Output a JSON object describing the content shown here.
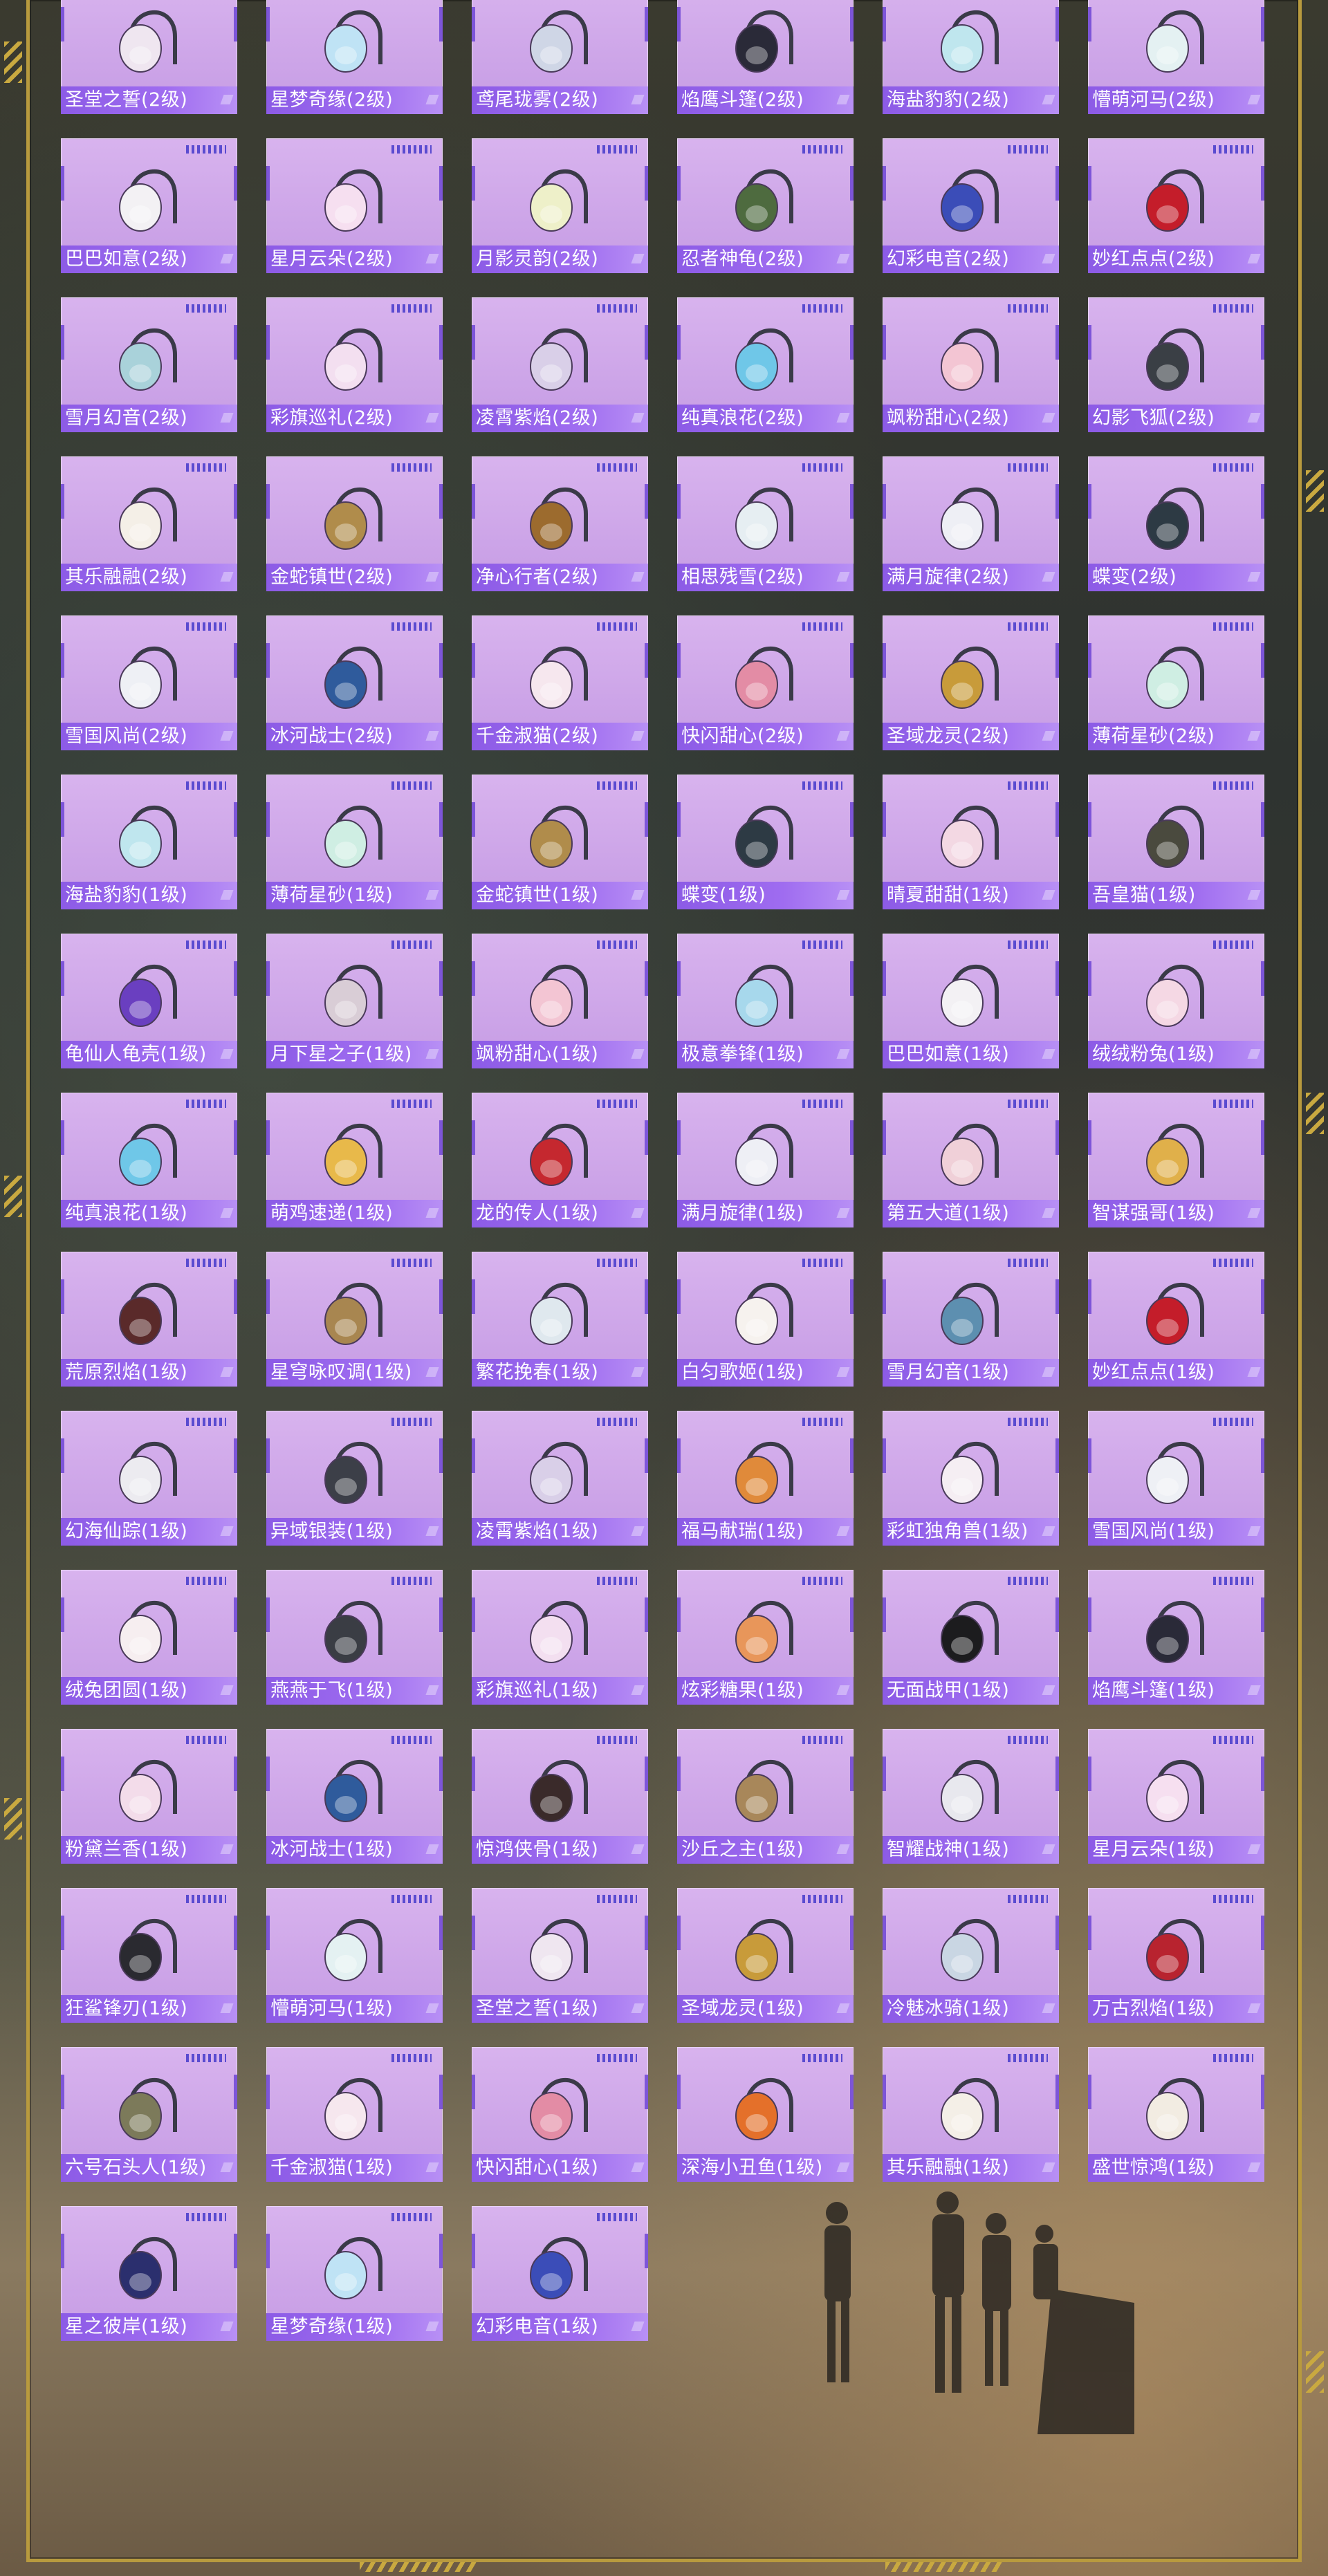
{
  "items": [
    {
      "name": "圣堂之誓(2级)",
      "icon": "bag-icon",
      "color": "#efe6f0"
    },
    {
      "name": "星梦奇缘(2级)",
      "icon": "bag-icon",
      "color": "#bfe3f5"
    },
    {
      "name": "鸢尾珑雾(2级)",
      "icon": "bag-icon",
      "color": "#cfd6e6"
    },
    {
      "name": "焰鹰斗篷(2级)",
      "icon": "bag-icon",
      "color": "#2a2a38"
    },
    {
      "name": "海盐豹豹(2级)",
      "icon": "bag-icon",
      "color": "#bfe6ee"
    },
    {
      "name": "懵萌河马(2级)",
      "icon": "bag-icon",
      "color": "#e4f1f2"
    },
    {
      "name": "巴巴如意(2级)",
      "icon": "bag-icon",
      "color": "#f3f1f4"
    },
    {
      "name": "星月云朵(2级)",
      "icon": "bag-icon",
      "color": "#f6dff0"
    },
    {
      "name": "月影灵韵(2级)",
      "icon": "bag-icon",
      "color": "#eef0c9"
    },
    {
      "name": "忍者神龟(2级)",
      "icon": "bag-icon",
      "color": "#4e6b3f"
    },
    {
      "name": "幻彩电音(2级)",
      "icon": "bag-icon",
      "color": "#3b4db8"
    },
    {
      "name": "妙红点点(2级)",
      "icon": "bag-icon",
      "color": "#c41d2a"
    },
    {
      "name": "雪月幻音(2级)",
      "icon": "bag-icon",
      "color": "#a9d2da"
    },
    {
      "name": "彩旗巡礼(2级)",
      "icon": "bag-icon",
      "color": "#f3dff0"
    },
    {
      "name": "凌霄紫焰(2级)",
      "icon": "bag-icon",
      "color": "#d9cfe8"
    },
    {
      "name": "纯真浪花(2级)",
      "icon": "bag-icon",
      "color": "#6fc7e8"
    },
    {
      "name": "飒粉甜心(2级)",
      "icon": "bag-icon",
      "color": "#f3c5d3"
    },
    {
      "name": "幻影飞狐(2级)",
      "icon": "bag-icon",
      "color": "#3a3f45"
    },
    {
      "name": "其乐融融(2级)",
      "icon": "bag-icon",
      "color": "#f4efe7"
    },
    {
      "name": "金蛇镇世(2级)",
      "icon": "bag-icon",
      "color": "#b08c4b"
    },
    {
      "name": "净心行者(2级)",
      "icon": "bag-icon",
      "color": "#9c6b2e"
    },
    {
      "name": "相思残雪(2级)",
      "icon": "bag-icon",
      "color": "#e6eef2"
    },
    {
      "name": "满月旋律(2级)",
      "icon": "bag-icon",
      "color": "#eeeff5"
    },
    {
      "name": "蝶变(2级)",
      "icon": "bag-icon",
      "color": "#2d3a44"
    },
    {
      "name": "雪国风尚(2级)",
      "icon": "bag-icon",
      "color": "#eef0f5"
    },
    {
      "name": "冰河战士(2级)",
      "icon": "bag-icon",
      "color": "#2f5b9c"
    },
    {
      "name": "千金淑猫(2级)",
      "icon": "bag-icon",
      "color": "#f6e7ee"
    },
    {
      "name": "快闪甜心(2级)",
      "icon": "bag-icon",
      "color": "#e38ca5"
    },
    {
      "name": "圣域龙灵(2级)",
      "icon": "bag-icon",
      "color": "#c89b3a"
    },
    {
      "name": "薄荷星砂(2级)",
      "icon": "bag-icon",
      "color": "#cfeee3"
    },
    {
      "name": "海盐豹豹(1级)",
      "icon": "bag-icon",
      "color": "#bfe6ee"
    },
    {
      "name": "薄荷星砂(1级)",
      "icon": "bag-icon",
      "color": "#cfeee3"
    },
    {
      "name": "金蛇镇世(1级)",
      "icon": "bag-icon",
      "color": "#b08c4b"
    },
    {
      "name": "蝶变(1级)",
      "icon": "bag-icon",
      "color": "#2d3a44"
    },
    {
      "name": "晴夏甜甜(1级)",
      "icon": "bag-icon",
      "color": "#f3d8e3"
    },
    {
      "name": "吾皇猫(1级)",
      "icon": "bag-icon",
      "color": "#4a4a3e"
    },
    {
      "name": "龟仙人龟壳(1级)",
      "icon": "bag-icon",
      "color": "#6a3fc0"
    },
    {
      "name": "月下星之子(1级)",
      "icon": "bag-icon",
      "color": "#d9cdd6"
    },
    {
      "name": "飒粉甜心(1级)",
      "icon": "bag-icon",
      "color": "#f3c5d3"
    },
    {
      "name": "极意拳锋(1级)",
      "icon": "bag-icon",
      "color": "#a7d8ec"
    },
    {
      "name": "巴巴如意(1级)",
      "icon": "bag-icon",
      "color": "#f3f1f4"
    },
    {
      "name": "绒绒粉兔(1级)",
      "icon": "bag-icon",
      "color": "#f5d8e4"
    },
    {
      "name": "纯真浪花(1级)",
      "icon": "bag-icon",
      "color": "#6fc7e8"
    },
    {
      "name": "萌鸡速递(1级)",
      "icon": "bag-icon",
      "color": "#e8b94a"
    },
    {
      "name": "龙的传人(1级)",
      "icon": "bag-icon",
      "color": "#c5282f"
    },
    {
      "name": "满月旋律(1级)",
      "icon": "bag-icon",
      "color": "#eeeff5"
    },
    {
      "name": "第五大道(1级)",
      "icon": "bag-icon",
      "color": "#f0d0d8"
    },
    {
      "name": "智谋强哥(1级)",
      "icon": "bag-icon",
      "color": "#e0b04a"
    },
    {
      "name": "荒原烈焰(1级)",
      "icon": "bag-icon",
      "color": "#5a2a2a"
    },
    {
      "name": "星穹咏叹调(1级)",
      "icon": "bag-icon",
      "color": "#a88650"
    },
    {
      "name": "繁花挽春(1级)",
      "icon": "bag-icon",
      "color": "#dfe8ee"
    },
    {
      "name": "白匀歌姬(1级)",
      "icon": "bag-icon",
      "color": "#f6f2ee"
    },
    {
      "name": "雪月幻音(1级)",
      "icon": "bag-icon",
      "color": "#5d8fb0"
    },
    {
      "name": "妙红点点(1级)",
      "icon": "bag-icon",
      "color": "#c41d2a"
    },
    {
      "name": "幻海仙踪(1级)",
      "icon": "bag-icon",
      "color": "#ecebf0"
    },
    {
      "name": "异域银装(1级)",
      "icon": "bag-icon",
      "color": "#3c3f48"
    },
    {
      "name": "凌霄紫焰(1级)",
      "icon": "bag-icon",
      "color": "#d9cfe8"
    },
    {
      "name": "福马献瑞(1级)",
      "icon": "bag-icon",
      "color": "#e08a3a"
    },
    {
      "name": "彩虹独角兽(1级)",
      "icon": "bag-icon",
      "color": "#f5eef3"
    },
    {
      "name": "雪国风尚(1级)",
      "icon": "bag-icon",
      "color": "#eef0f5"
    },
    {
      "name": "绒兔团圆(1级)",
      "icon": "bag-icon",
      "color": "#f6eef0"
    },
    {
      "name": "燕燕于飞(1级)",
      "icon": "bag-icon",
      "color": "#3a3d44"
    },
    {
      "name": "彩旗巡礼(1级)",
      "icon": "bag-icon",
      "color": "#f3dff0"
    },
    {
      "name": "炫彩糖果(1级)",
      "icon": "bag-icon",
      "color": "#e8965a"
    },
    {
      "name": "无面战甲(1级)",
      "icon": "bag-icon",
      "color": "#1c1c1e"
    },
    {
      "name": "焰鹰斗篷(1级)",
      "icon": "bag-icon",
      "color": "#2a2a38"
    },
    {
      "name": "粉黛兰香(1级)",
      "icon": "bag-icon",
      "color": "#f3dcea"
    },
    {
      "name": "冰河战士(1级)",
      "icon": "bag-icon",
      "color": "#2f5b9c"
    },
    {
      "name": "惊鸿侠骨(1级)",
      "icon": "bag-icon",
      "color": "#3a2a2a"
    },
    {
      "name": "沙丘之主(1级)",
      "icon": "bag-icon",
      "color": "#a8875a"
    },
    {
      "name": "智耀战神(1级)",
      "icon": "bag-icon",
      "color": "#e8e8ee"
    },
    {
      "name": "星月云朵(1级)",
      "icon": "bag-icon",
      "color": "#f6dff0"
    },
    {
      "name": "狂鲨锋刃(1级)",
      "icon": "bag-icon",
      "color": "#2a2a30"
    },
    {
      "name": "懵萌河马(1级)",
      "icon": "bag-icon",
      "color": "#e4f1f2"
    },
    {
      "name": "圣堂之誓(1级)",
      "icon": "bag-icon",
      "color": "#efe6f0"
    },
    {
      "name": "圣域龙灵(1级)",
      "icon": "bag-icon",
      "color": "#c89b3a"
    },
    {
      "name": "冷魅冰骑(1级)",
      "icon": "bag-icon",
      "color": "#c9d6e3"
    },
    {
      "name": "万古烈焰(1级)",
      "icon": "bag-icon",
      "color": "#b8232f"
    },
    {
      "name": "六号石头人(1级)",
      "icon": "bag-icon",
      "color": "#7c7a5a"
    },
    {
      "name": "千金淑猫(1级)",
      "icon": "bag-icon",
      "color": "#f6e7ee"
    },
    {
      "name": "快闪甜心(1级)",
      "icon": "bag-icon",
      "color": "#e38ca5"
    },
    {
      "name": "深海小丑鱼(1级)",
      "icon": "bag-icon",
      "color": "#e4702a"
    },
    {
      "name": "其乐融融(1级)",
      "icon": "bag-icon",
      "color": "#f4efe7"
    },
    {
      "name": "盛世惊鸿(1级)",
      "icon": "bag-icon",
      "color": "#f2ece2"
    },
    {
      "name": "星之彼岸(1级)",
      "icon": "bag-icon",
      "color": "#2b2f6e"
    },
    {
      "name": "星梦奇缘(1级)",
      "icon": "bag-icon",
      "color": "#bfe3f5"
    },
    {
      "name": "幻彩电音(1级)",
      "icon": "bag-icon",
      "color": "#3b4db8"
    }
  ],
  "colors": {
    "card_bg": "#d2aaed",
    "label_bg": "#9564ec",
    "frame": "#b89a3e"
  }
}
